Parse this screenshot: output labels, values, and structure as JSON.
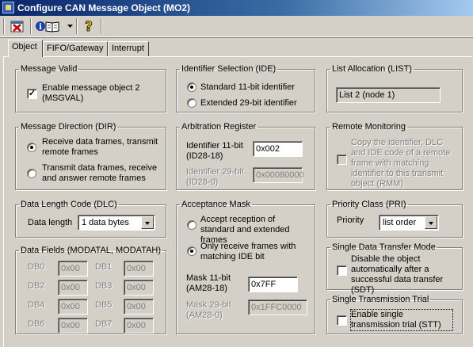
{
  "window": {
    "title": "Configure CAN Message Object (MO2)"
  },
  "toolbar": {
    "close_icon": "close-x-icon",
    "info_icon": "info-book-icon",
    "help_icon": "help-question-icon"
  },
  "tabs": [
    "Object",
    "FIFO/Gateway",
    "Interrupt"
  ],
  "message_valid": {
    "title": "Message Valid",
    "label": "Enable message object 2 (MSGVAL)",
    "checked": true
  },
  "identifier_selection": {
    "title": "Identifier Selection (IDE)",
    "opt1": "Standard 11-bit identifier",
    "opt2": "Extended 29-bit identifier",
    "selected": "opt1"
  },
  "list_allocation": {
    "title": "List Allocation (LIST)",
    "value": "List 2 (node 1)"
  },
  "message_direction": {
    "title": "Message Direction (DIR)",
    "opt1": "Receive data frames, transmit remote frames",
    "opt2": "Transmit data frames, receive and answer remote frames",
    "selected": "opt1"
  },
  "arbitration": {
    "title": "Arbitration Register",
    "id11_label": "Identifier 11-bit (ID28-18)",
    "id11_value": "0x002",
    "id29_label": "Identifier 29-bit (ID28-0)",
    "id29_value": "0x00080000"
  },
  "remote_monitoring": {
    "title": "Remote Monitoring",
    "label": "Copy the identifier, DLC and IDE code of a remote frame with matching identifier to this transmit object (RMM)",
    "checked": false
  },
  "dlc": {
    "title": "Data Length Code (DLC)",
    "label": "Data length",
    "value": "1 data bytes"
  },
  "acceptance_mask": {
    "title": "Acceptance Mask",
    "opt1": "Accept reception of standard and extended frames",
    "opt2": "Only receive frames with matching IDE bit",
    "selected": "opt2",
    "mask11_label": "Mask 11-bit (AM28-18)",
    "mask11_value": "0x7FF",
    "mask29_label": "Mask 29-bit (AM28-0)",
    "mask29_value": "0x1FFC0000"
  },
  "priority": {
    "title": "Priority Class (PRI)",
    "label": "Priority",
    "value": "list order"
  },
  "data_fields": {
    "title": "Data Fields (MODATAL, MODATAH)",
    "db": [
      {
        "label": "DB0",
        "value": "0x00"
      },
      {
        "label": "DB1",
        "value": "0x00"
      },
      {
        "label": "DB2",
        "value": "0x00"
      },
      {
        "label": "DB3",
        "value": "0x00"
      },
      {
        "label": "DB4",
        "value": "0x00"
      },
      {
        "label": "DB5",
        "value": "0x00"
      },
      {
        "label": "DB6",
        "value": "0x00"
      },
      {
        "label": "DB7",
        "value": "0x00"
      }
    ]
  },
  "single_data_transfer": {
    "title": "Single Data Transfer Mode",
    "label": "Disable the object automatically after a successful data transfer (SDT)",
    "checked": false
  },
  "single_transmission": {
    "title": "Single Transmission Trial",
    "label": "Enable single transmission trial (STT)",
    "checked": false
  },
  "colors": {
    "titlebar_start": "#0a246a",
    "titlebar_end": "#a6caf0",
    "face": "#d4d0c8"
  }
}
